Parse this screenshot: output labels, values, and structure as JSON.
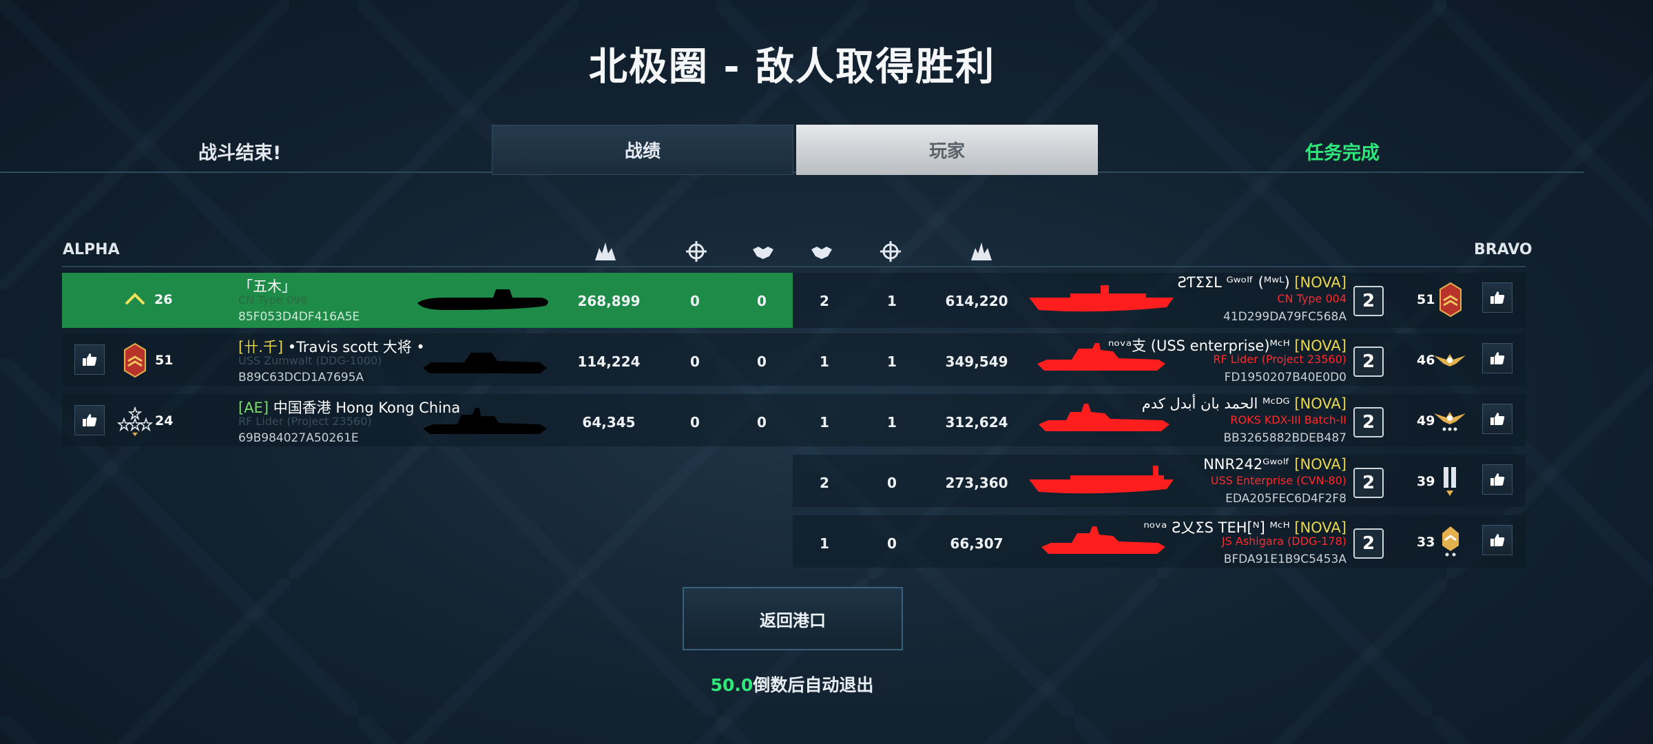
{
  "title": "北极圈 - 敌人取得胜利",
  "battle_over": "战斗结束!",
  "mission_complete": "任务完成",
  "tabs": {
    "stats": "战绩",
    "players": "玩家"
  },
  "teams": {
    "left": "ALPHA",
    "right": "BRAVO"
  },
  "alpha": [
    {
      "rank": "26",
      "name": "「五木」",
      "ship": "CN Type 096",
      "id": "85F053D4DF416A5E",
      "damage": "268,899",
      "kills": "0",
      "assists": "0",
      "highlight": true
    },
    {
      "rank": "51",
      "clan": "[卄.千]",
      "name": " •Travis scott 大将 •",
      "ship": "USS Zumwalt (DDG-1000)",
      "id": "B89C63DCD1A7695A",
      "damage": "114,224",
      "kills": "0",
      "assists": "0"
    },
    {
      "rank": "24",
      "clan": "[AE]",
      "name": " 中国香港 Hong Kong China",
      "ship": "RF Lider (Project 23560)",
      "id": "69B984027A50261E",
      "damage": "64,345",
      "kills": "0",
      "assists": "0"
    }
  ],
  "bravo": [
    {
      "assists": "2",
      "kills": "1",
      "damage": "614,220",
      "name": "ƧƬΣΣL ᴳʷᵒˡᶠ (ᴹʷᴸ)",
      "clan": "[NOVA]",
      "ship": "CN Type 004",
      "id": "41D299DA79FC568A",
      "place": "2",
      "rank": "51"
    },
    {
      "assists": "1",
      "kills": "1",
      "damage": "349,549",
      "name": "ⁿᵒᵛᵃ支 (USS enterprise)ᴹᶜᴴ",
      "clan": "[NOVA]",
      "ship": "RF Lider (Project 23560)",
      "id": "FD1950207B40E0D0",
      "place": "2",
      "rank": "46"
    },
    {
      "assists": "1",
      "kills": "1",
      "damage": "312,624",
      "name": "الحمد بان أبدل كدم ᴹᶜᴰᴳ",
      "clan": "[NOVA]",
      "ship": "ROKS KDX-III Batch-II",
      "id": "BB3265882BDEB487",
      "place": "2",
      "rank": "49"
    },
    {
      "assists": "2",
      "kills": "0",
      "damage": "273,360",
      "name": "NNR242ᴳʷᵒˡᶠ",
      "clan": "[NOVA]",
      "ship": "USS Enterprise (CVN-80)",
      "id": "EDA205FEC6D4F2F8",
      "place": "2",
      "rank": "39"
    },
    {
      "assists": "1",
      "kills": "0",
      "damage": "66,307",
      "name": "ⁿᵒᵛᵃ Ƨ乂ΣS TEH[ᴺ] ᴹᶜᴴ",
      "clan": "[NOVA]",
      "ship": "JS Ashigara (DDG-178)",
      "id": "BFDA91E1B9C5453A",
      "place": "2",
      "rank": "33"
    }
  ],
  "return_button": "返回港口",
  "countdown": {
    "value": "50.0",
    "text": "倒数后自动退出"
  },
  "colors": {
    "accent_green": "#2ee87a",
    "clan_yellow": "#e8d84a",
    "enemy_red": "#ff2a2a",
    "highlight_row": "#1e8b48"
  },
  "icons": {
    "damage": "explosion-icon",
    "kills": "crosshair-icon",
    "assists": "handshake-icon",
    "like": "thumbs-up-icon",
    "self": "chevron-up-icon"
  }
}
